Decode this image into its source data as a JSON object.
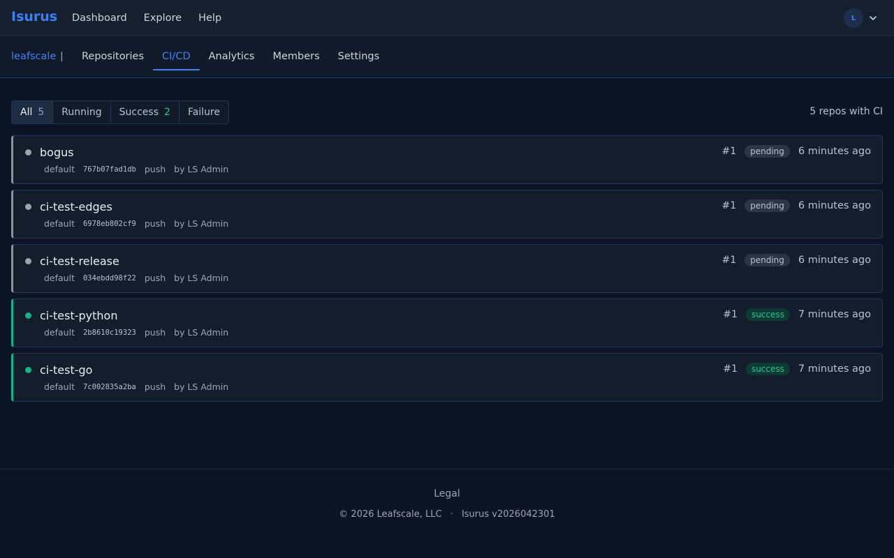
{
  "topbar": {
    "brand": "Isurus",
    "nav": [
      "Dashboard",
      "Explore",
      "Help"
    ],
    "avatar_initial": "L"
  },
  "subnav": {
    "org": "leafscale",
    "separator": "|",
    "tabs": [
      "Repositories",
      "CI/CD",
      "Analytics",
      "Members",
      "Settings"
    ],
    "active_tab": "CI/CD"
  },
  "filters": {
    "items": [
      {
        "label": "All",
        "count": "5"
      },
      {
        "label": "Running",
        "count": ""
      },
      {
        "label": "Success",
        "count": "2"
      },
      {
        "label": "Failure",
        "count": ""
      }
    ],
    "active": "All",
    "summary": "5 repos with CI"
  },
  "runs": [
    {
      "name": "bogus",
      "branch": "default",
      "sha": "767b07fad1db",
      "event": "push",
      "author": "by LS Admin",
      "number": "#1",
      "status": "pending",
      "time": "6 minutes ago"
    },
    {
      "name": "ci-test-edges",
      "branch": "default",
      "sha": "6978eb802cf9",
      "event": "push",
      "author": "by LS Admin",
      "number": "#1",
      "status": "pending",
      "time": "6 minutes ago"
    },
    {
      "name": "ci-test-release",
      "branch": "default",
      "sha": "034ebdd98f22",
      "event": "push",
      "author": "by LS Admin",
      "number": "#1",
      "status": "pending",
      "time": "6 minutes ago"
    },
    {
      "name": "ci-test-python",
      "branch": "default",
      "sha": "2b8610c19323",
      "event": "push",
      "author": "by LS Admin",
      "number": "#1",
      "status": "success",
      "time": "7 minutes ago"
    },
    {
      "name": "ci-test-go",
      "branch": "default",
      "sha": "7c002835a2ba",
      "event": "push",
      "author": "by LS Admin",
      "number": "#1",
      "status": "success",
      "time": "7 minutes ago"
    }
  ],
  "footer": {
    "legal": "Legal",
    "copyright": "© 2026 Leafscale, LLC",
    "dot": "·",
    "version": "Isurus v2026042301"
  },
  "colors": {
    "accent": "#3b82f6",
    "success": "#14b38a",
    "pending": "#9aa3af",
    "background": "#0b1324"
  }
}
